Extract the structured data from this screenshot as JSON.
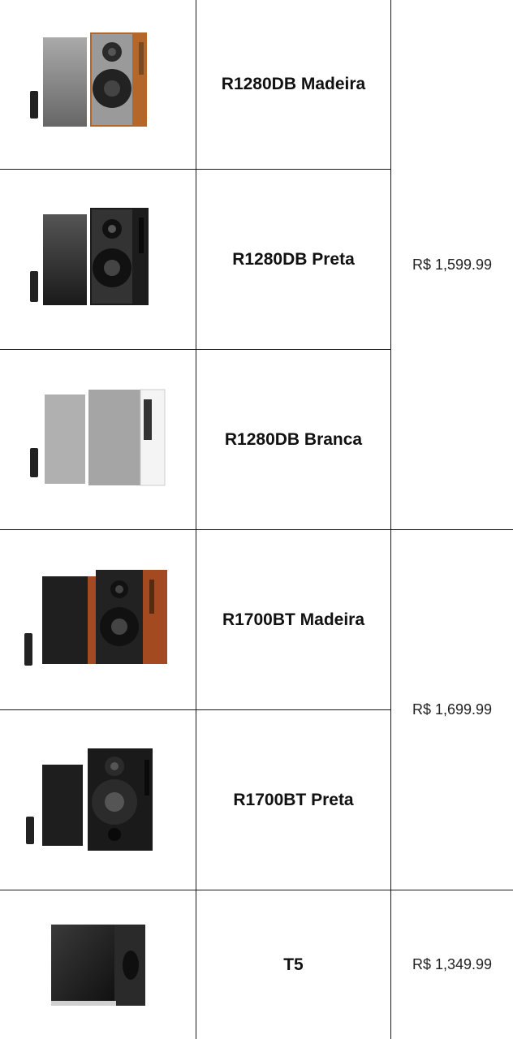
{
  "products": [
    {
      "name": "R1280DB Madeira",
      "image": "speaker-pair-wood-icon"
    },
    {
      "name": "R1280DB Preta",
      "image": "speaker-pair-black-icon"
    },
    {
      "name": "R1280DB Branca",
      "image": "speaker-pair-white-icon"
    },
    {
      "name": "R1700BT Madeira",
      "image": "speaker-pair-wood-black-icon"
    },
    {
      "name": "R1700BT Preta",
      "image": "speaker-pair-black-icon"
    },
    {
      "name": "T5",
      "image": "subwoofer-icon"
    }
  ],
  "prices": [
    {
      "value": "R$ 1,599.99"
    },
    {
      "value": "R$ 1,699.99"
    },
    {
      "value": "R$ 1,349.99"
    }
  ],
  "colors": {
    "border": "#1a1a1a",
    "wood": "#b5672a",
    "black": "#1c1c1c",
    "grey": "#9a9a9a",
    "white": "#f2f2f2"
  }
}
